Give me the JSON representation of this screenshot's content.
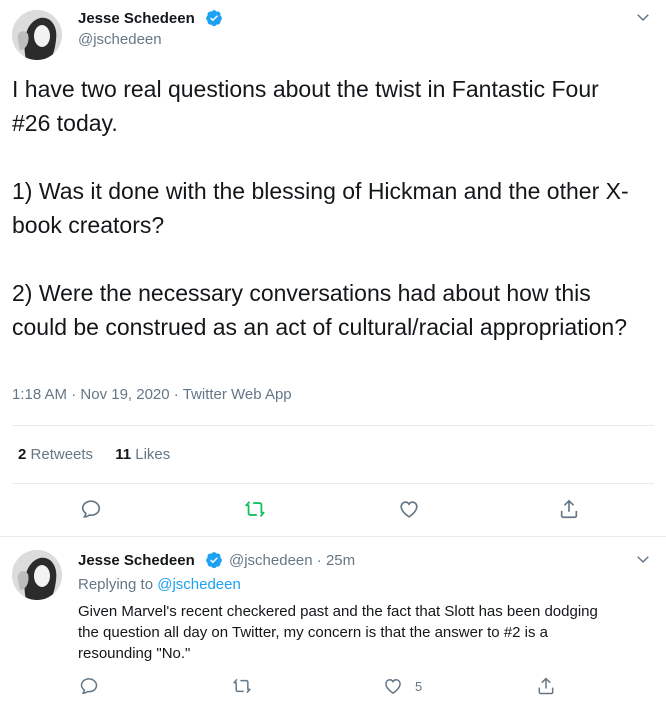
{
  "colors": {
    "accent": "#1da1f2",
    "retweet_active": "#17bf63",
    "muted": "#657786",
    "text": "#14171a",
    "divider": "#e6ecf0"
  },
  "main_tweet": {
    "author_name": "Jesse Schedeen",
    "author_handle": "@jschedeen",
    "verified_icon": "verified-badge-icon",
    "text": "I have two real questions about the twist in Fantastic Four #26 today.\n\n1) Was it done with the blessing of Hickman and the other X-book creators?\n\n2) Were the necessary conversations had about how this could be construed as an act of cultural/racial appropriation?",
    "time": "1:18 AM",
    "date": "Nov 19, 2020",
    "source": "Twitter Web App",
    "retweets_count": "2",
    "retweets_label": "Retweets",
    "likes_count": "11",
    "likes_label": "Likes",
    "actions": [
      "reply-icon",
      "retweet-icon",
      "like-icon",
      "share-icon"
    ]
  },
  "reply_tweet": {
    "author_name": "Jesse Schedeen",
    "author_handle": "@jschedeen",
    "age": "25m",
    "replying_prefix": "Replying to",
    "replying_to": "@jschedeen",
    "text": "Given Marvel's recent checkered past and the fact that Slott has been dodging the question all day on Twitter, my concern is that the answer to #2 is a resounding \"No.\"",
    "likes_count": "5",
    "actions": [
      "reply-icon",
      "retweet-icon",
      "like-icon",
      "share-icon"
    ]
  }
}
